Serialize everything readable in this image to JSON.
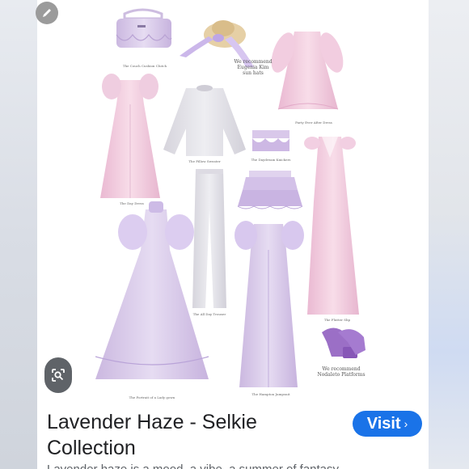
{
  "result": {
    "title_line1": "Lavender Haze - Selkie",
    "title_line2": "Collection",
    "visit_label": "Visit",
    "visit_chevron": "›",
    "snippet": "Lavender haze is a mood, a vibe, a summer of fantasy"
  },
  "icons": {
    "edit": "pencil-icon",
    "lens": "google-lens-icon"
  },
  "collage": {
    "captions": {
      "clutch": "The Couch Cushion Clutch",
      "recommend_hat": "We recommend\nEugenia Kim\nsun hats",
      "party_dress": "Party Ever After Dress",
      "day_dress": "The Day Dress",
      "pillow_sweater": "The Pillow Sweater",
      "daydream_knickers": "The Daydream Knickers",
      "flutter_slip": "The Flutter Slip",
      "allday_trousers": "The All Day Trouser",
      "portrait_gown": "The Portrait of a Lady gown",
      "hampton_jumpsuit": "The Hampton Jumpsuit",
      "recommend_platforms": "We recommend\nNodaleto Platforms"
    }
  },
  "colors": {
    "visit_button": "#1a73e8",
    "lavender": "#d9c8ea",
    "pink": "#f1cfe0"
  }
}
